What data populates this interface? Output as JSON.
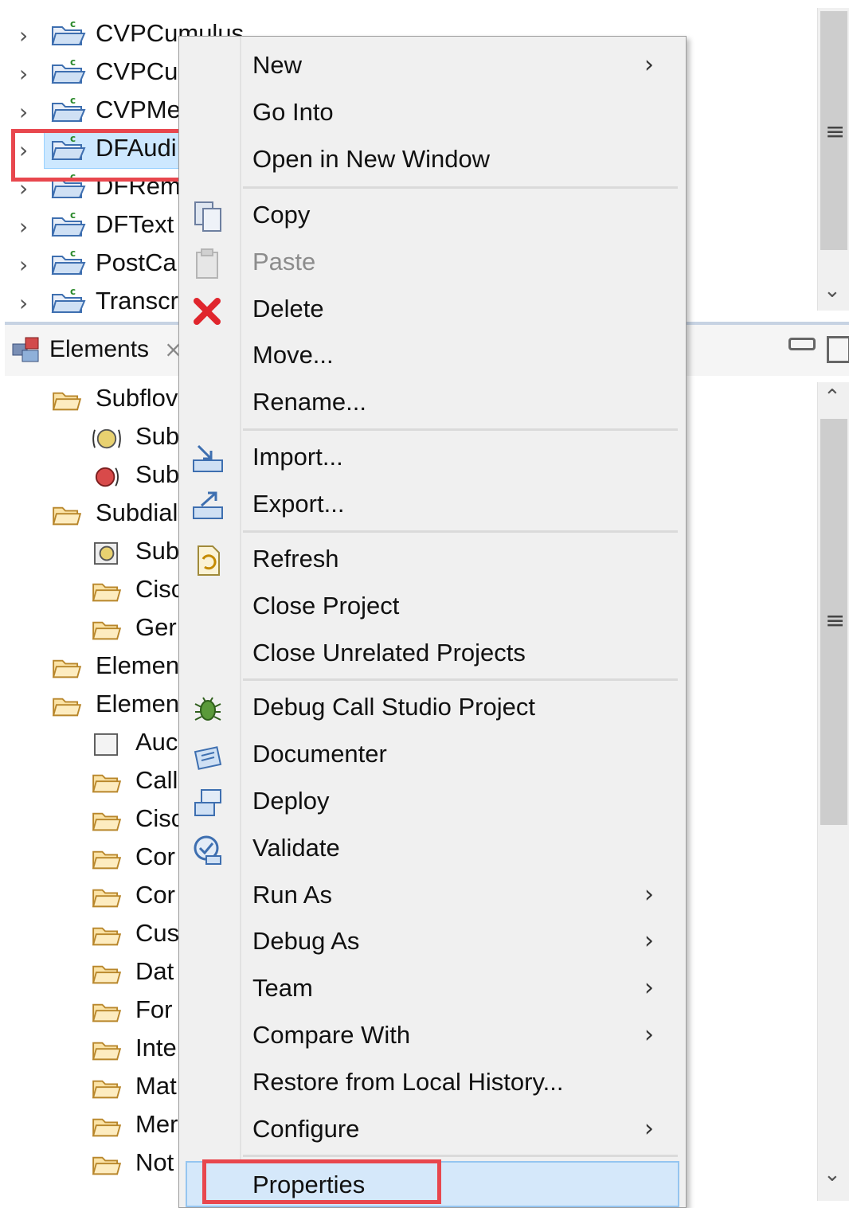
{
  "project_tree": [
    {
      "label": "CVPCumulus"
    },
    {
      "label": "CVPCu"
    },
    {
      "label": "CVPMe"
    },
    {
      "label": "DFAudi"
    },
    {
      "label": "DFRem"
    },
    {
      "label": "DFText"
    },
    {
      "label": "PostCa"
    },
    {
      "label": "Transcr"
    }
  ],
  "elements_view": {
    "title": "Elements",
    "items": [
      {
        "label": "Subflov"
      },
      {
        "label": "Sub"
      },
      {
        "label": "Sub"
      },
      {
        "label": "Subdial"
      },
      {
        "label": "Sub"
      },
      {
        "label": "Cisc"
      },
      {
        "label": "Ger"
      },
      {
        "label": "Elemen"
      },
      {
        "label": "Elemen"
      },
      {
        "label": "Auc"
      },
      {
        "label": "Call"
      },
      {
        "label": "Cisc"
      },
      {
        "label": "Cor"
      },
      {
        "label": "Cor"
      },
      {
        "label": "Cus"
      },
      {
        "label": "Dat"
      },
      {
        "label": "For"
      },
      {
        "label": "Inte"
      },
      {
        "label": "Mat"
      },
      {
        "label": "Mer"
      },
      {
        "label": "Not"
      }
    ]
  },
  "context_menu": {
    "new": "New",
    "go_into": "Go Into",
    "open_new_window": "Open in New Window",
    "copy": "Copy",
    "paste": "Paste",
    "delete": "Delete",
    "move": "Move...",
    "rename": "Rename...",
    "import": "Import...",
    "export": "Export...",
    "refresh": "Refresh",
    "close_project": "Close Project",
    "close_unrelated": "Close Unrelated Projects",
    "debug_call_studio": "Debug Call Studio Project",
    "documenter": "Documenter",
    "deploy": "Deploy",
    "validate": "Validate",
    "run_as": "Run As",
    "debug_as": "Debug As",
    "team": "Team",
    "compare_with": "Compare With",
    "restore_history": "Restore from Local History...",
    "configure": "Configure",
    "properties": "Properties"
  },
  "colors": {
    "highlight_red": "#e8474e",
    "selection_blue": "#cde8ff",
    "menu_bg": "#f0f0f0"
  }
}
